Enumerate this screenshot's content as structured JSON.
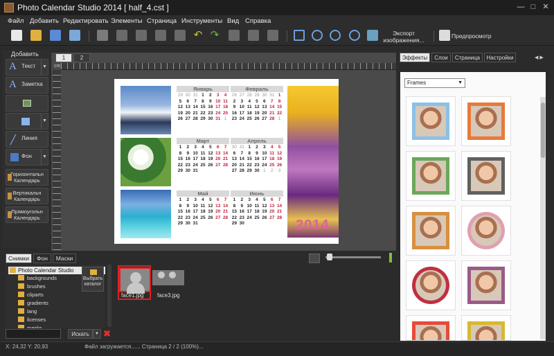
{
  "window": {
    "title": "Photo Calendar Studio 2014 [ half_4.cst ]",
    "minimize": "—",
    "maximize": "□",
    "close": "✕"
  },
  "menu": [
    "Файл",
    "Добавить",
    "Редактировать",
    "Элементы",
    "Страница",
    "Инструменты",
    "Вид",
    "Справка"
  ],
  "toolbar": {
    "export_label": "Экспорт изображения...",
    "preview_label": "Предпросмотр"
  },
  "left_panel": {
    "title": "Добавить",
    "text": "Текст",
    "note": "Заметка",
    "line": "Линия",
    "background": "Фон",
    "horizontal": "Горизонтальн Календарь",
    "vertical": "Вертикальн Календарь",
    "rect": "Прямоугольн Календарь"
  },
  "workspace": {
    "page_tabs": [
      "1",
      "2"
    ],
    "ruler_unit": "cm"
  },
  "calendar": {
    "year": "2014",
    "months": [
      {
        "name": "Январь",
        "days": [
          "29",
          "30",
          "31",
          "1",
          "2",
          "3",
          "4",
          "5",
          "6",
          "7",
          "8",
          "9",
          "10",
          "11",
          "12",
          "13",
          "14",
          "15",
          "16",
          "17",
          "18",
          "19",
          "20",
          "21",
          "22",
          "23",
          "24",
          "25",
          "26",
          "27",
          "28",
          "29",
          "30",
          "31",
          "1"
        ]
      },
      {
        "name": "Февраль",
        "days": [
          "26",
          "27",
          "28",
          "29",
          "30",
          "31",
          "1",
          "2",
          "3",
          "4",
          "5",
          "6",
          "7",
          "8",
          "9",
          "10",
          "11",
          "12",
          "13",
          "14",
          "15",
          "16",
          "17",
          "18",
          "19",
          "20",
          "21",
          "22",
          "23",
          "24",
          "25",
          "26",
          "27",
          "28",
          "1"
        ]
      },
      {
        "name": "Март",
        "days": [
          "1",
          "2",
          "3",
          "4",
          "5",
          "6",
          "7",
          "8",
          "9",
          "10",
          "11",
          "12",
          "13",
          "14",
          "15",
          "16",
          "17",
          "18",
          "19",
          "20",
          "21",
          "22",
          "23",
          "24",
          "25",
          "26",
          "27",
          "28",
          "29",
          "30",
          "31"
        ]
      },
      {
        "name": "Апрель",
        "days": [
          "30",
          "31",
          "1",
          "2",
          "3",
          "4",
          "5",
          "6",
          "7",
          "8",
          "9",
          "10",
          "11",
          "12",
          "13",
          "14",
          "15",
          "16",
          "17",
          "18",
          "19",
          "20",
          "21",
          "22",
          "23",
          "24",
          "25",
          "26",
          "27",
          "28",
          "29",
          "30",
          "1",
          "2",
          "3"
        ]
      },
      {
        "name": "Май",
        "days": [
          "1",
          "2",
          "3",
          "4",
          "5",
          "6",
          "7",
          "8",
          "9",
          "10",
          "11",
          "12",
          "13",
          "14",
          "15",
          "16",
          "17",
          "18",
          "19",
          "20",
          "21",
          "22",
          "23",
          "24",
          "25",
          "26",
          "27",
          "28",
          "29",
          "30",
          "31"
        ]
      },
      {
        "name": "Июнь",
        "days": [
          "1",
          "2",
          "3",
          "4",
          "5",
          "6",
          "7",
          "8",
          "9",
          "10",
          "11",
          "12",
          "13",
          "14",
          "15",
          "16",
          "17",
          "18",
          "19",
          "20",
          "21",
          "22",
          "23",
          "24",
          "25",
          "26",
          "27",
          "28",
          "29",
          "30"
        ]
      }
    ]
  },
  "bottom": {
    "tabs": [
      "Снимки",
      "Фон",
      "Маски"
    ],
    "tree_root": "Photo Calendar Studio",
    "folders": [
      "backgrounds",
      "brushes",
      "cliparts",
      "gradients",
      "lang",
      "licenses",
      "masks"
    ],
    "select_folder": "Выбрать каталог",
    "search_button": "Искать",
    "thumbnails": [
      "face1.jpg",
      "face3.jpg"
    ]
  },
  "status": {
    "coords": "X: 24,32 Y: 20,93",
    "message": "Файл загружается...... Страница 2 / 2 (100%)..."
  },
  "right_panel": {
    "tabs": [
      "Эффекты",
      "Слои",
      "Страница",
      "Настройки"
    ],
    "category": "Frames"
  },
  "frame_colors": [
    "#8cc0e8",
    "#e87a3a",
    "#6aa858",
    "#606060",
    "#d89040",
    "#e0a0b0",
    "#c03040",
    "#9a5a8a",
    "#e84a3a",
    "#d8b830"
  ]
}
